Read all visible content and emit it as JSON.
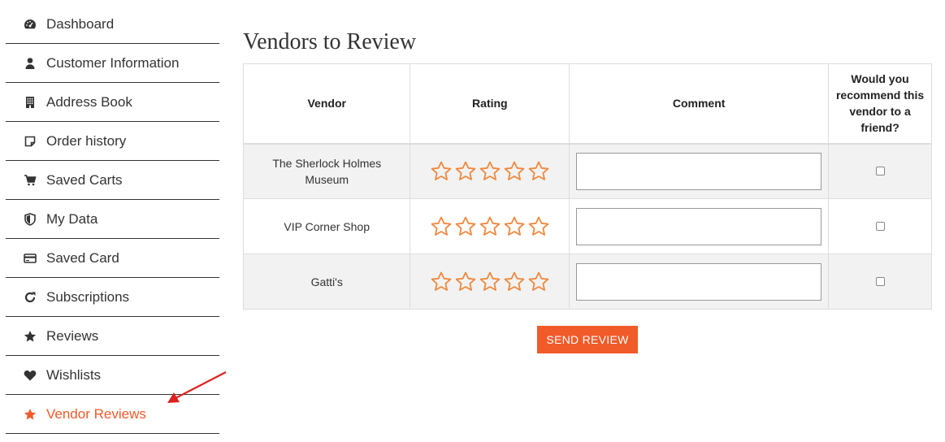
{
  "sidebar": {
    "items": [
      {
        "label": "Dashboard",
        "icon": "dashboard-icon"
      },
      {
        "label": "Customer Information",
        "icon": "user-icon"
      },
      {
        "label": "Address Book",
        "icon": "building-icon"
      },
      {
        "label": "Order history",
        "icon": "note-icon"
      },
      {
        "label": "Saved Carts",
        "icon": "cart-icon"
      },
      {
        "label": "My Data",
        "icon": "shield-icon"
      },
      {
        "label": "Saved Card",
        "icon": "credit-card-icon"
      },
      {
        "label": "Subscriptions",
        "icon": "refresh-icon"
      },
      {
        "label": "Reviews",
        "icon": "star-icon"
      },
      {
        "label": "Wishlists",
        "icon": "heart-icon"
      },
      {
        "label": "Vendor Reviews",
        "icon": "star-icon",
        "active": true
      }
    ]
  },
  "main": {
    "title": "Vendors to Review",
    "table": {
      "headers": {
        "vendor": "Vendor",
        "rating": "Rating",
        "comment": "Comment",
        "recommend": "Would you recommend this vendor to a friend?"
      },
      "rows": [
        {
          "vendor": "The Sherlock Holmes Museum",
          "rating": 0,
          "comment": "",
          "recommend": false
        },
        {
          "vendor": "VIP Corner Shop",
          "rating": 0,
          "comment": "",
          "recommend": false
        },
        {
          "vendor": "Gatti's",
          "rating": 0,
          "comment": "",
          "recommend": false
        }
      ]
    },
    "send_label": "SEND REVIEW"
  },
  "colors": {
    "accent": "#f15a29",
    "star_outline": "#f0883e",
    "annotation_arrow": "#e02020"
  }
}
